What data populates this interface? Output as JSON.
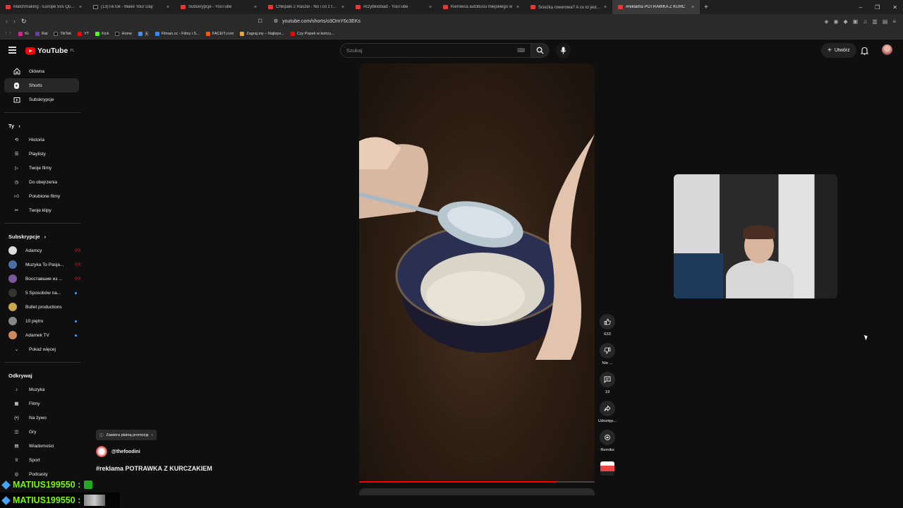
{
  "browser": {
    "tabs": [
      {
        "label": "Matchmaking - Europe 5v5 Queue -"
      },
      {
        "label": "(13)TikTok - Make Your Day"
      },
      {
        "label": "Subskrypcje - YouTube"
      },
      {
        "label": "Chłopaki z Raszei - No i co z tego -"
      },
      {
        "label": "#czybkiobiad - YouTube"
      },
      {
        "label": "Kierowca autobusu miejskiego w"
      },
      {
        "label": "Ścieżka rowerowa? A co to jest? 😬"
      },
      {
        "label": "#reklama POTRAWKA Z KURC"
      }
    ],
    "url": "youtube.com/shorts/o3OmY6c3EKs",
    "bookmarks": [
      "IG",
      "Rat",
      "TikTok",
      "YT",
      "Kick",
      "Home",
      "天",
      "Filman.cc - Filmy i S...",
      "FACEIT.com",
      "Zagraj.my – Najleps...",
      "Czy Popek w końcu..."
    ]
  },
  "header": {
    "logo_text": "YouTube",
    "logo_region": "PL",
    "search_placeholder": "Szukaj",
    "create_label": "Utwórz"
  },
  "sidebar": {
    "main": [
      {
        "label": "Główna",
        "icon": "home-icon"
      },
      {
        "label": "Shorts",
        "icon": "shorts-icon",
        "active": true
      },
      {
        "label": "Subskrypcje",
        "icon": "subscriptions-icon"
      }
    ],
    "you_heading": "Ty",
    "you": [
      {
        "label": "Historia",
        "icon": "history-icon"
      },
      {
        "label": "Playlisty",
        "icon": "playlists-icon"
      },
      {
        "label": "Twoje filmy",
        "icon": "your-videos-icon"
      },
      {
        "label": "Do obejrzenia",
        "icon": "watch-later-icon"
      },
      {
        "label": "Polubione filmy",
        "icon": "liked-icon"
      },
      {
        "label": "Twoje klipy",
        "icon": "clips-icon"
      }
    ],
    "subs_heading": "Subskrypcje",
    "subs": [
      {
        "label": "Adamcy",
        "color": "#dddddd",
        "badge": "live"
      },
      {
        "label": "Muzyka To Pasja...",
        "color": "#4a6fa5",
        "badge": "live"
      },
      {
        "label": "Восставшие из ...",
        "color": "#7a5a9a",
        "badge": "live"
      },
      {
        "label": "5 Sposobów na...",
        "color": "#333333",
        "badge": "dot"
      },
      {
        "label": "Bullet productions",
        "color": "#c9a84a",
        "badge": ""
      },
      {
        "label": "10 piętro",
        "color": "#888888",
        "badge": "dot"
      },
      {
        "label": "Adamek TV",
        "color": "#d08a5a",
        "badge": "dot"
      }
    ],
    "show_more": "Pokaż więcej",
    "explore_heading": "Odkrywaj",
    "explore": [
      {
        "label": "Muzyka",
        "icon": "music-icon"
      },
      {
        "label": "Filmy",
        "icon": "movies-icon"
      },
      {
        "label": "Na żywo",
        "icon": "live-icon"
      },
      {
        "label": "Gry",
        "icon": "gaming-icon"
      },
      {
        "label": "Wiadomości",
        "icon": "news-icon"
      },
      {
        "label": "Sport",
        "icon": "sport-icon"
      },
      {
        "label": "Podcasty",
        "icon": "podcasts-icon"
      }
    ]
  },
  "short": {
    "progress": 0.84,
    "promo_label": "Zawiera płatną promocję",
    "channel": "@thefoodini",
    "title": "#reklama POTRAWKA Z KURCZAKIEM",
    "likes": "633",
    "dislike_label": "Nie ...",
    "comments": "19",
    "share_label": "Udostęp...",
    "remix_label": "Remiks"
  },
  "chat": [
    {
      "user": "MATIUS199550 :"
    },
    {
      "user": "MATIUS199550 :"
    }
  ]
}
